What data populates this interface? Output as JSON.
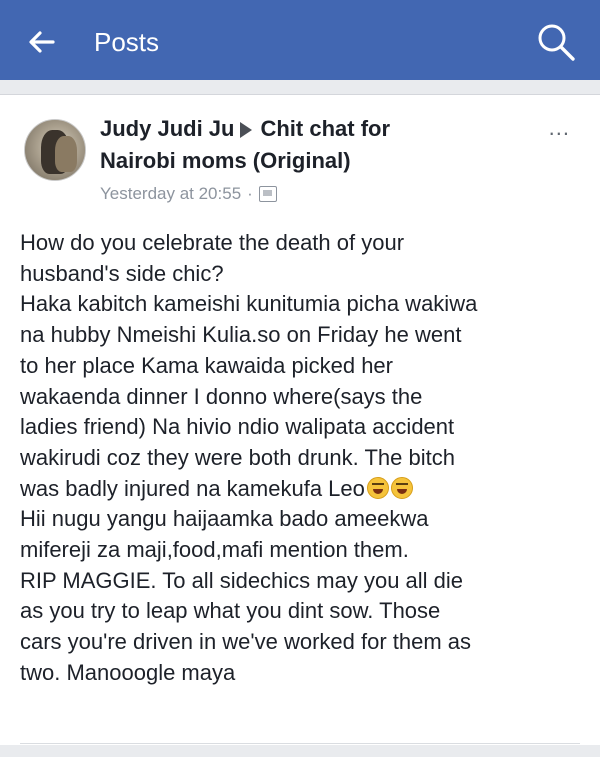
{
  "topbar": {
    "title": "Posts",
    "back_icon": "arrow-left-icon",
    "search_icon": "search-icon",
    "background": "#4267b2"
  },
  "post": {
    "author": "Judy Judi Ju",
    "group": "Chit chat for",
    "group_line2": "Nairobi moms (Original)",
    "more": "...",
    "timestamp": "Yesterday at 20:55",
    "separator": "·",
    "audience_icon": "group-audience-icon",
    "lines": [
      "How do you celebrate the death of your",
      "husband's side chic?",
      "Haka kabitch kameishi kunitumia picha wakiwa",
      "na hubby Nmeishi Kulia.so on Friday he went",
      "to her place Kama kawaida picked her",
      "wakaenda dinner I donno where(says the",
      "ladies friend) Na hivio ndio walipata accident",
      "wakirudi coz they were both drunk. The bitch",
      "was badly injured na kamekufa Leo",
      "Hii nugu yangu haijaamka bado ameekwa",
      "mifereji za maji,food,mafi mention them.",
      "RIP MAGGIE. To all sidechics may you all die",
      "as you try to leap what you dint sow. Those",
      "cars you're driven in we've worked for them as",
      "two. Manooogle maya"
    ],
    "emoji_icon": "laughing-emoji-icon"
  }
}
